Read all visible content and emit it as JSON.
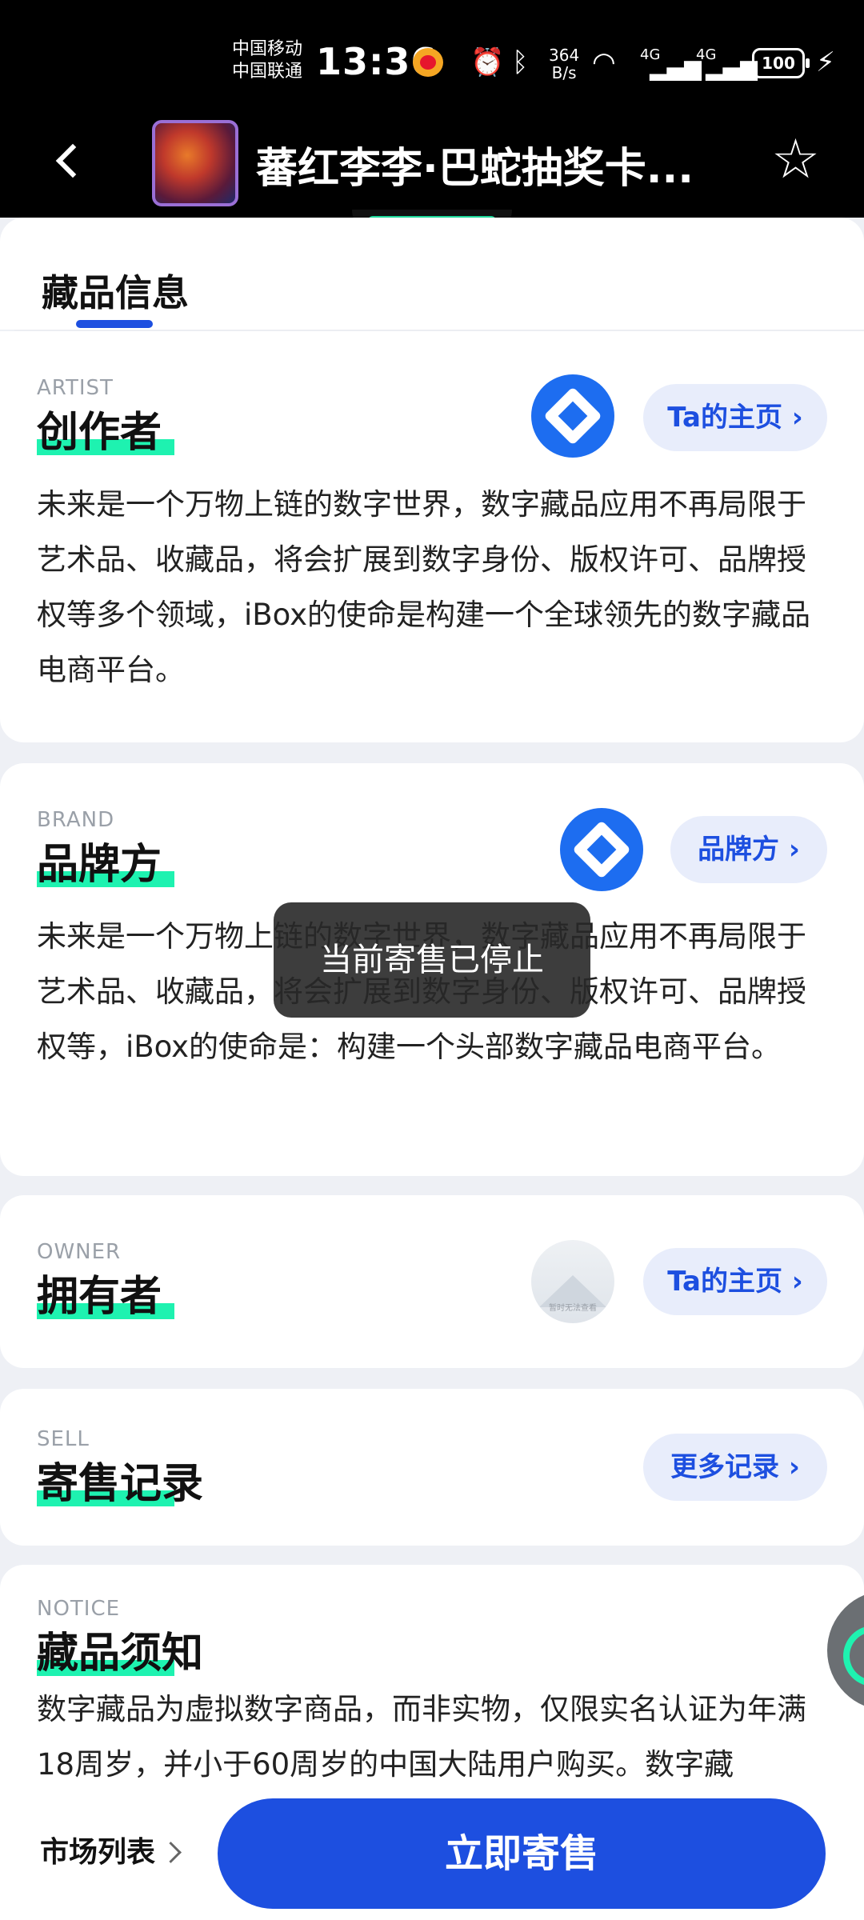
{
  "status_bar": {
    "carrier_1": "中国移动",
    "carrier_2": "中国联通",
    "time": "13:36",
    "net_speed_value": "364",
    "net_speed_unit": "B/s",
    "signal_1": "4G",
    "signal_2": "4G",
    "battery": "100"
  },
  "header": {
    "title": "蕃红李李·巴蛇抽奖卡..."
  },
  "tab": {
    "label": "藏品信息"
  },
  "artist": {
    "en": "ARTIST",
    "zh": "创作者",
    "button": "Ta的主页 ›",
    "description": "未来是一个万物上链的数字世界，数字藏品应用不再局限于艺术品、收藏品，将会扩展到数字身份、版权许可、品牌授权等多个领域，iBox的使命是构建一个全球领先的数字藏品电商平台。"
  },
  "brand": {
    "en": "BRAND",
    "zh": "品牌方",
    "button": "品牌方 ›",
    "description": "未来是一个万物上链的数字世界，数字藏品应用不再局限于艺术品、收藏品，将会扩展到数字身份、版权许可、品牌授权等，iBox的使命是：构建一个头部数字藏品电商平台。"
  },
  "owner": {
    "en": "OWNER",
    "zh": "拥有者",
    "button": "Ta的主页 ›",
    "avatar_placeholder": "暂时无法查看"
  },
  "sell": {
    "en": "SELL",
    "zh": "寄售记录",
    "button": "更多记录 ›"
  },
  "notice": {
    "en": "NOTICE",
    "zh": "藏品须知",
    "description": "数字藏品为虚拟数字商品，而非实物，仅限实名认证为年满18周岁，并小于60周岁的中国大陆用户购买。数字藏"
  },
  "toast": {
    "text": "当前寄售已停止"
  },
  "bottom_bar": {
    "market_label": "市场列表",
    "cta_label": "立即寄售"
  },
  "colors": {
    "accent_blue": "#1d4fe0",
    "highlight_green": "#1ef2b0",
    "pill_bg": "#e8edfb"
  }
}
